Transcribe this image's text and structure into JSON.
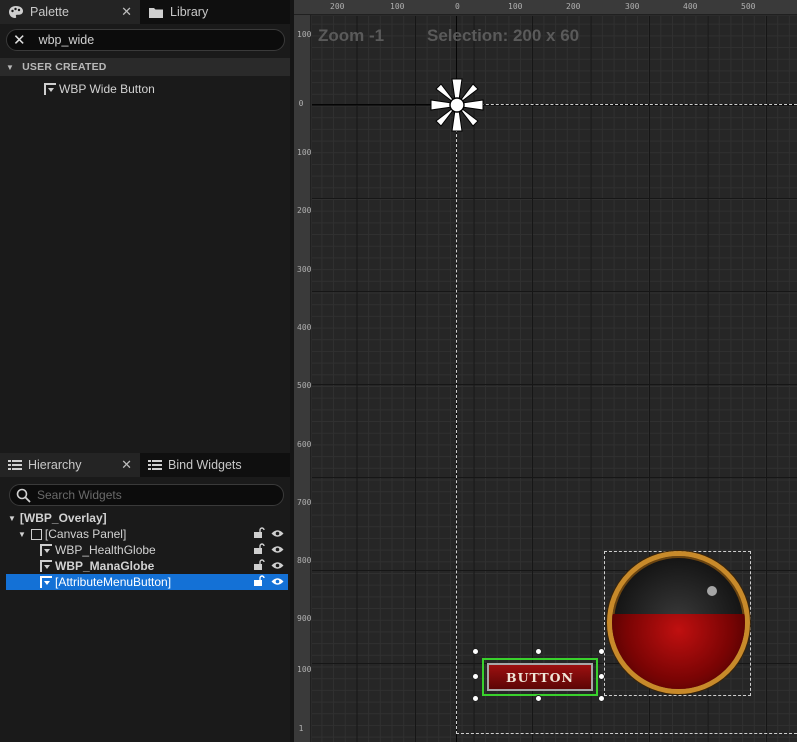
{
  "palette": {
    "tab_label": "Palette",
    "library_tab_label": "Library",
    "search_value": "wbp_wide",
    "section_header": "USER CREATED",
    "items": [
      {
        "label": "WBP Wide Button"
      }
    ]
  },
  "hierarchy": {
    "tab_label": "Hierarchy",
    "bind_widgets_tab_label": "Bind Widgets",
    "search_placeholder": "Search Widgets",
    "tree": [
      {
        "label": "[WBP_Overlay]",
        "bold": true
      },
      {
        "label": "[Canvas Panel]"
      },
      {
        "label": "WBP_HealthGlobe"
      },
      {
        "label": "WBP_ManaGlobe",
        "bold": true
      },
      {
        "label": "[AttributeMenuButton]",
        "selected": true
      }
    ]
  },
  "designer": {
    "zoom_text": "Zoom -1",
    "selection_text": "Selection: 200 x 60",
    "ruler_top_labels": [
      "200",
      "100",
      "0",
      "100",
      "200",
      "300",
      "400",
      "500"
    ],
    "ruler_left_labels": [
      "100",
      "0",
      "100",
      "200",
      "300",
      "400",
      "500",
      "600",
      "700",
      "800",
      "900",
      "100",
      "1"
    ],
    "button_text": "BUTTON"
  },
  "colors": {
    "selection_blue": "#1471d6",
    "selection_green": "#39d12c",
    "globe_rim": "#c88a2a",
    "globe_liquid": "#a00b0b"
  },
  "icons": {
    "palette_tab": "palette-icon",
    "library_tab": "folder-icon",
    "hierarchy_tab": "list-icon",
    "bind_widgets_tab": "list-icon",
    "search_clear": "close-icon",
    "search": "magnifier-icon",
    "visibility": "eye-icon",
    "lock": "unlock-icon",
    "anchor": "anchor-icon"
  }
}
